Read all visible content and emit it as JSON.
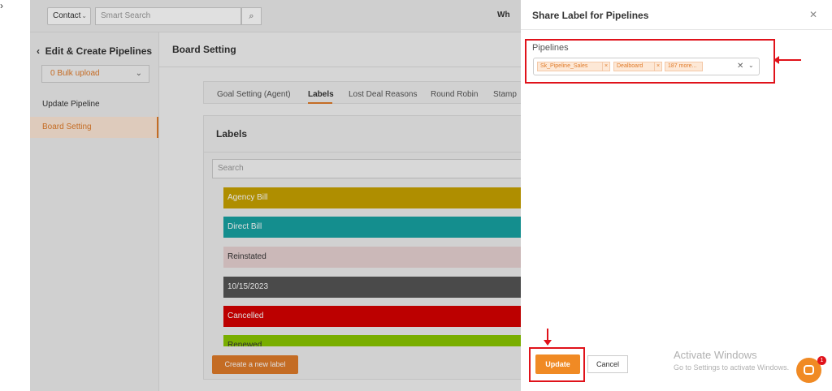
{
  "topbar": {
    "contact_label": "Contact",
    "search_placeholder": "Smart Search",
    "right_text": "Wh"
  },
  "sidepanel": {
    "title": "Edit & Create Pipelines",
    "bulk_upload": "0 Bulk upload",
    "items": [
      {
        "label": "Update Pipeline"
      },
      {
        "label": "Board Setting"
      }
    ]
  },
  "main": {
    "title": "Board Setting",
    "tabs": [
      {
        "label": "Goal Setting (Agent)"
      },
      {
        "label": "Labels"
      },
      {
        "label": "Lost Deal Reasons"
      },
      {
        "label": "Round Robin"
      },
      {
        "label": "Stamp"
      }
    ],
    "labels_title": "Labels",
    "search_placeholder": "Search",
    "labels": [
      {
        "name": "Agency Bill",
        "color": "#c8a200"
      },
      {
        "name": "Direct Bill",
        "color": "#17a2a2"
      },
      {
        "name": "Reinstated",
        "color": "#e8d2d2"
      },
      {
        "name": "10/15/2023",
        "color": "#555555"
      },
      {
        "name": "Cancelled",
        "color": "#d60000"
      },
      {
        "name": "Renewed",
        "color": "#8ac700"
      }
    ],
    "create_button": "Create a new label"
  },
  "modal": {
    "title": "Share Label for Pipelines",
    "field_label": "Pipelines",
    "chips": [
      {
        "label": "Sk_Pipeline_Sales"
      },
      {
        "label": "Dealboard"
      }
    ],
    "more_chip": "187 more...",
    "update_button": "Update",
    "cancel_button": "Cancel"
  },
  "watermark": {
    "line1": "Activate Windows",
    "line2": "Go to Settings to activate Windows."
  },
  "chat": {
    "badge": "1"
  },
  "colors": {
    "accent": "#f08a24",
    "annotation": "#e0121a"
  }
}
